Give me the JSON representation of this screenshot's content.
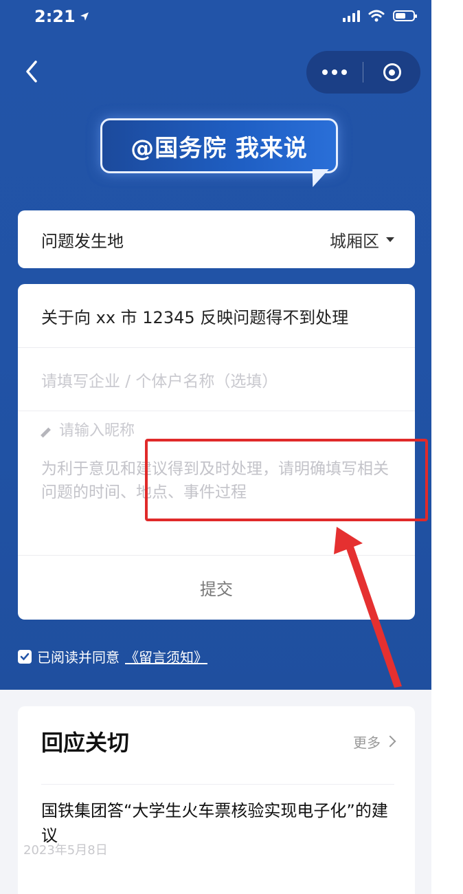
{
  "status_bar": {
    "time": "2:21",
    "location_arrow": "location-arrow-icon"
  },
  "nav": {
    "back_icon": "chevron-left-icon",
    "more_icon": "more-dots-icon",
    "close_icon": "target-circle-icon"
  },
  "banner": {
    "text": "@国务院  我来说"
  },
  "form": {
    "location_label": "问题发生地",
    "location_value": "城厢区",
    "title_value": "关于向 xx 市 12345 反映问题得不到处理",
    "company_placeholder": "请填写企业 / 个体户名称（选填）",
    "nickname_placeholder": "请输入昵称",
    "description_placeholder": "为利于意见和建议得到及时处理，请明确填写相关问题的时间、地点、事件过程",
    "submit_label": "提交",
    "agree_text": "已阅读并同意",
    "agree_link": "《留言须知》",
    "agree_checked": true
  },
  "news": {
    "section_title": "回应关切",
    "more_label": "更多",
    "items": [
      {
        "title": "国铁集团答“大学生火车票核验实现电子化”的建议",
        "date": "2023年5月8日"
      }
    ]
  },
  "colors": {
    "header_blue": "#2254a8",
    "annotation_red": "#e02a2a",
    "card_white": "#ffffff"
  }
}
